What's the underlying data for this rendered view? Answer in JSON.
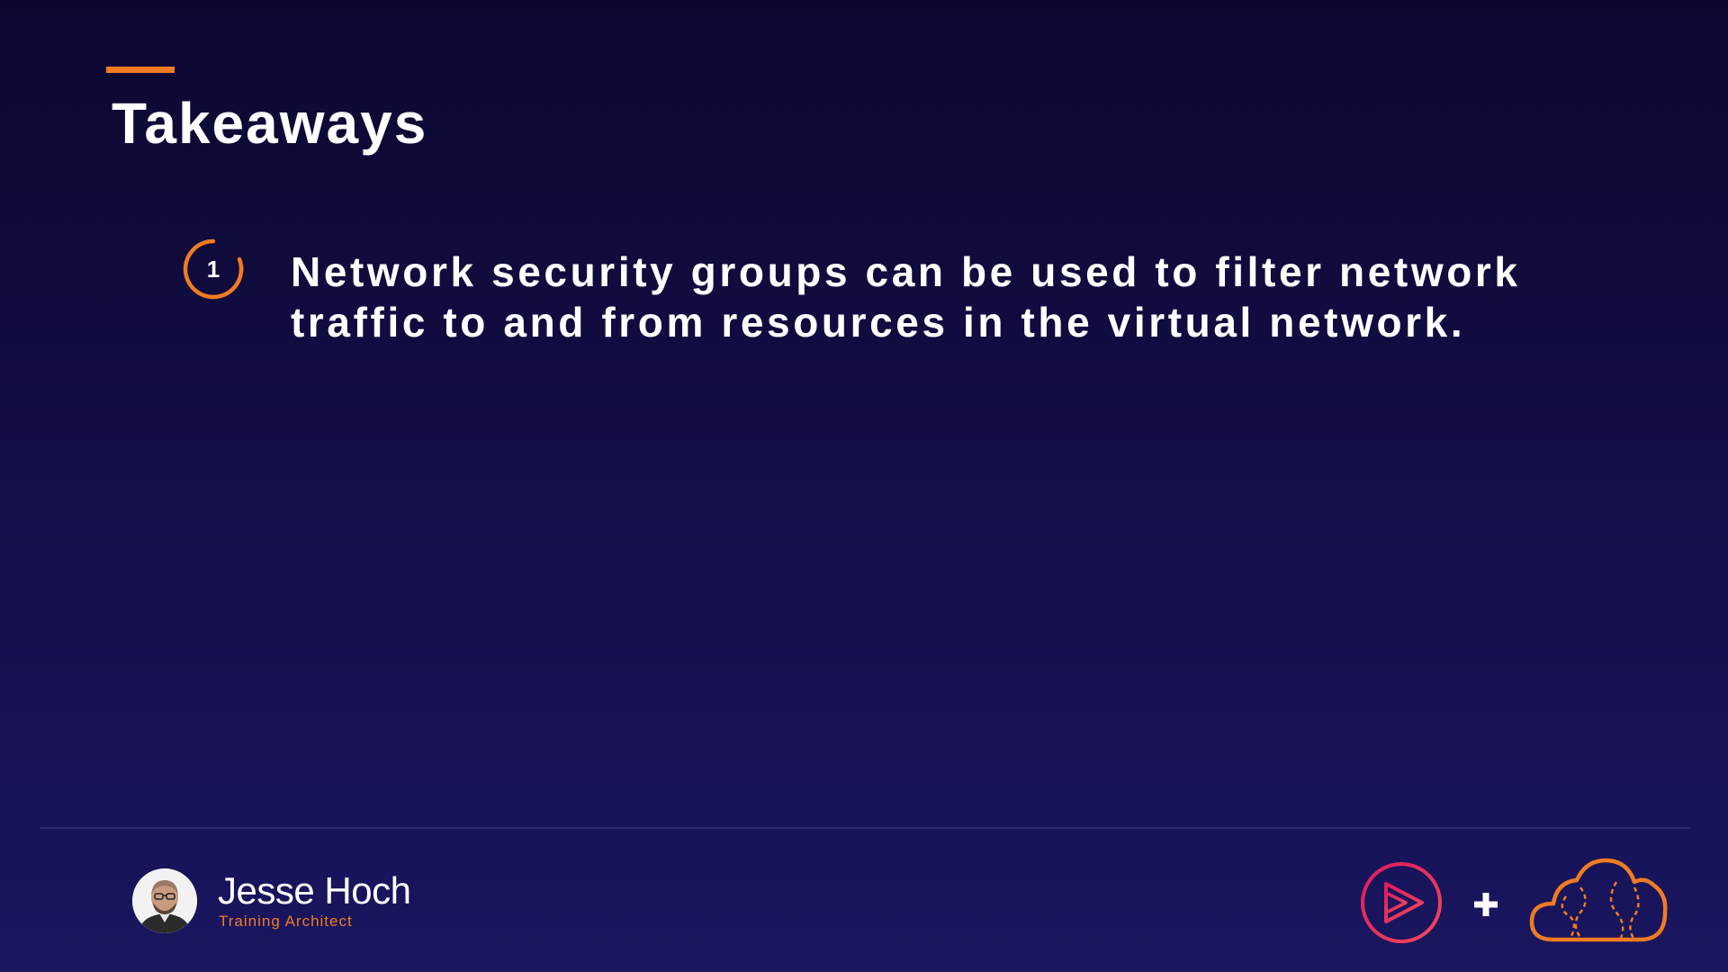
{
  "slide": {
    "title": "Takeaways",
    "takeaways": [
      {
        "number": "1",
        "text": "Network security groups can be used to filter network traffic to and from resources in the virtual network."
      }
    ]
  },
  "footer": {
    "presenter_name": "Jesse Hoch",
    "presenter_role": "Training Architect",
    "logos": [
      "play-logo-icon",
      "plus-icon",
      "cloud-logo-icon"
    ]
  },
  "colors": {
    "background_top": "#0b0830",
    "background_bottom": "#1a1660",
    "accent_orange": "#f07b22",
    "logo_pink": "#e1195f",
    "text": "#ffffff"
  }
}
